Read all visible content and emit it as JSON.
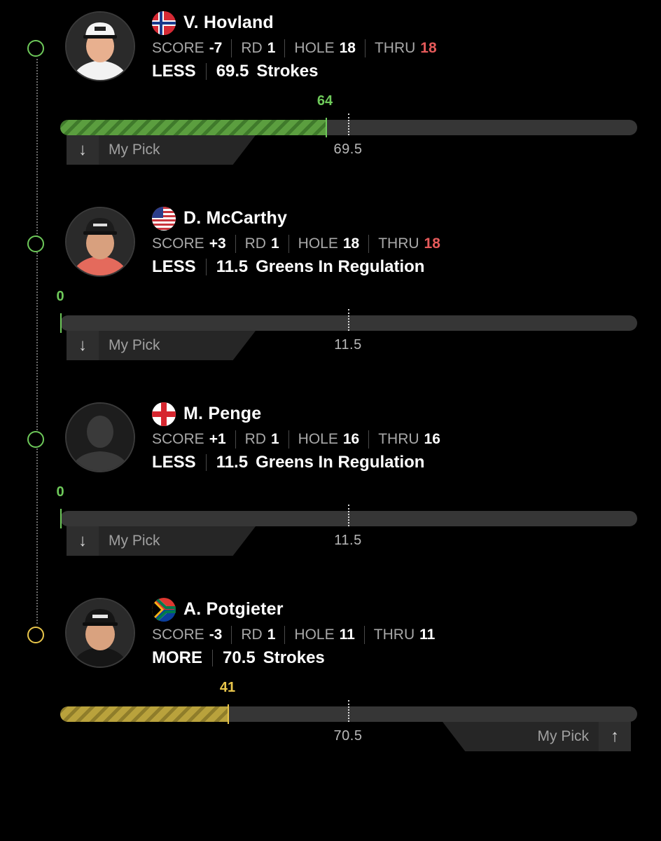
{
  "labels": {
    "score": "SCORE",
    "rd": "RD",
    "hole": "HOLE",
    "thru": "THRU",
    "my_pick": "My Pick"
  },
  "icons": {
    "down": "arrow-down-icon",
    "up": "arrow-up-icon"
  },
  "colors": {
    "green": "#6ec95a",
    "gold": "#e9c64b",
    "red": "#e65a5a"
  },
  "players": [
    {
      "name": "V. Hovland",
      "flag": "norway",
      "score": "-7",
      "rd": "1",
      "hole": "18",
      "thru": "18",
      "direction": "LESS",
      "line": "69.5",
      "stat": "Strokes",
      "current": "64",
      "status": "green",
      "progress_percent": 46
    },
    {
      "name": "D. McCarthy",
      "flag": "usa",
      "score": "+3",
      "rd": "1",
      "hole": "18",
      "thru": "18",
      "direction": "LESS",
      "line": "11.5",
      "stat": "Greens In Regulation",
      "current": "0",
      "status": "green",
      "progress_percent": 0
    },
    {
      "name": "M. Penge",
      "flag": "england",
      "score": "+1",
      "rd": "1",
      "hole": "16",
      "thru": "16",
      "direction": "LESS",
      "line": "11.5",
      "stat": "Greens In Regulation",
      "current": "0",
      "status": "green",
      "progress_percent": 0
    },
    {
      "name": "A. Potgieter",
      "flag": "south-africa",
      "score": "-3",
      "rd": "1",
      "hole": "11",
      "thru": "11",
      "direction": "MORE",
      "line": "70.5",
      "stat": "Strokes",
      "current": "41",
      "status": "gold",
      "progress_percent": 29
    }
  ]
}
